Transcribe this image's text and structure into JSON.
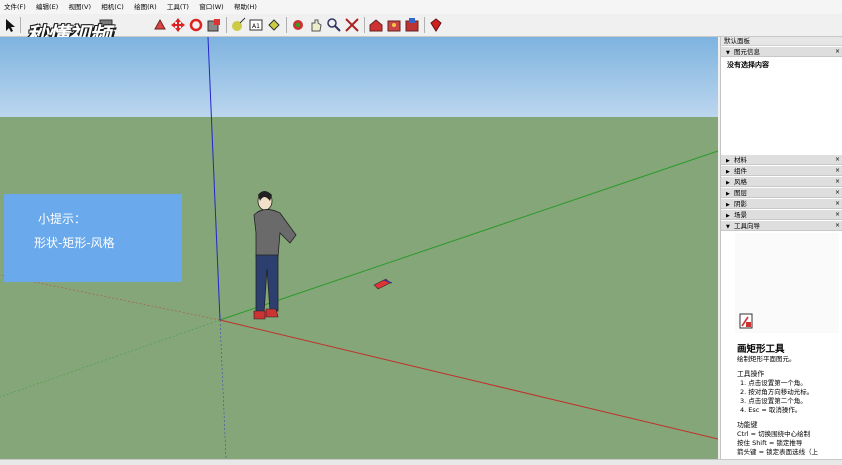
{
  "menu": [
    "文件(F)",
    "编辑(E)",
    "视图(V)",
    "相机(C)",
    "绘图(R)",
    "工具(T)",
    "窗口(W)",
    "帮助(H)"
  ],
  "watermark": "秒懂视频",
  "tip": {
    "title": "小提示：",
    "text": "形状-矩形-风格"
  },
  "panel": {
    "title": "默认面板",
    "entity_info": {
      "label": "图元信息",
      "content": "没有选择内容"
    },
    "trays": [
      "材料",
      "组件",
      "风格",
      "图层",
      "阴影",
      "场景"
    ],
    "instructor": {
      "label": "工具向导",
      "tool_name": "画矩形工具",
      "tool_desc": "绘制矩形平面图元。",
      "ops_title": "工具操作",
      "ops": [
        "1. 点击设置第一个角。",
        "2. 按对角方向移动光标。",
        "3. 点击设置第二个角。",
        "4. Esc = 取消操作。"
      ],
      "keys_title": "功能键",
      "keys": [
        "Ctrl = 切换围绕中心绘制",
        "按住 Shift = 锁定推导",
        "箭头键 = 锁定表面选线（上"
      ]
    }
  },
  "colors": {
    "sky_top": "#7eb3df",
    "ground": "#85a679",
    "tip_bg": "#6aa9eb",
    "axis_red": "#c0302a",
    "axis_green": "#2a9a2a",
    "axis_blue": "#2525c8"
  }
}
